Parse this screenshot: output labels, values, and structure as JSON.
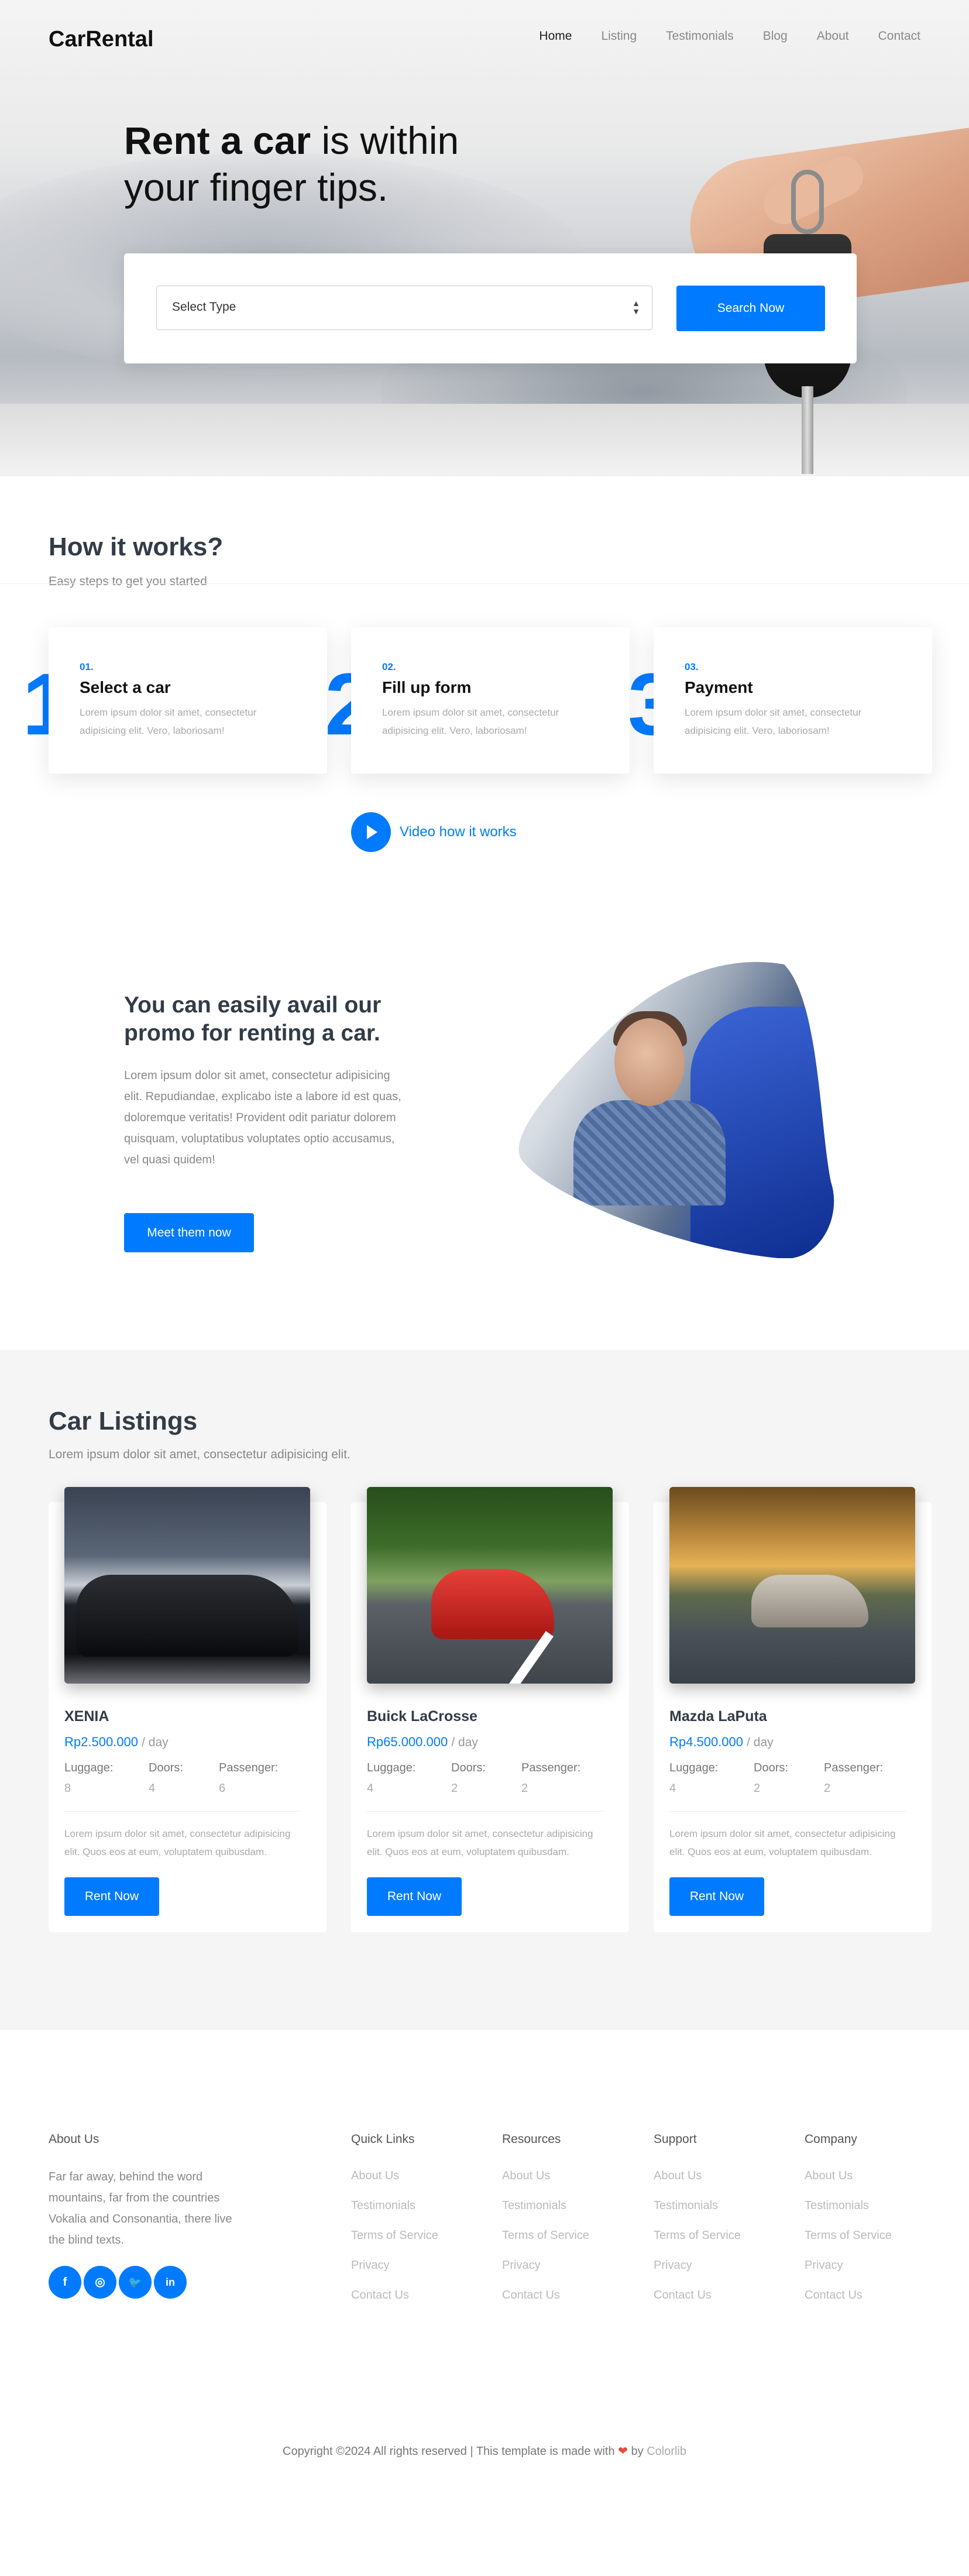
{
  "nav": {
    "logo": "CarRental",
    "items": [
      {
        "label": "Home",
        "active": true
      },
      {
        "label": "Listing"
      },
      {
        "label": "Testimonials"
      },
      {
        "label": "Blog"
      },
      {
        "label": "About"
      },
      {
        "label": "Contact"
      }
    ]
  },
  "hero": {
    "title_bold": "Rent a car",
    "title_rest1": " is within",
    "title_rest2": "your finger tips.",
    "select_value": "Select Type",
    "search_button": "Search Now"
  },
  "how": {
    "title": "How it works?",
    "subtitle": "Easy steps to get you started",
    "steps": [
      {
        "big": "1",
        "num": "01.",
        "title": "Select a car",
        "desc": "Lorem ipsum dolor sit amet, consectetur adipisicing elit. Vero, laboriosam!"
      },
      {
        "big": "2",
        "num": "02.",
        "title": "Fill up form",
        "desc": "Lorem ipsum dolor sit amet, consectetur adipisicing elit. Vero, laboriosam!"
      },
      {
        "big": "3",
        "num": "03.",
        "title": "Payment",
        "desc": "Lorem ipsum dolor sit amet, consectetur adipisicing elit. Vero, laboriosam!"
      }
    ],
    "video_link": "Video how it works"
  },
  "promo": {
    "title": "You can easily avail our promo for renting a car.",
    "text": "Lorem ipsum dolor sit amet, consectetur adipisicing elit. Repudiandae, explicabo iste a labore id est quas, doloremque veritatis! Provident odit pariatur dolorem quisquam, voluptatibus voluptates optio accusamus, vel quasi quidem!",
    "button": "Meet them now"
  },
  "listings": {
    "title": "Car Listings",
    "subtitle": "Lorem ipsum dolor sit amet, consectetur adipisicing elit.",
    "spec_labels": {
      "luggage": "Luggage:",
      "doors": "Doors:",
      "passenger": "Passenger:"
    },
    "per_day": "/ day",
    "rent_button": "Rent Now",
    "cars": [
      {
        "name": "XENIA",
        "price": "Rp2.500.000",
        "luggage": "8",
        "doors": "4",
        "passenger": "6",
        "desc": "Lorem ipsum dolor sit amet, consectetur adipisicing elit. Quos eos at eum, voluptatem quibusdam."
      },
      {
        "name": "Buick LaCrosse",
        "price": "Rp65.000.000",
        "luggage": "4",
        "doors": "2",
        "passenger": "2",
        "desc": "Lorem ipsum dolor sit amet, consectetur adipisicing elit. Quos eos at eum, voluptatem quibusdam."
      },
      {
        "name": "Mazda LaPuta",
        "price": "Rp4.500.000",
        "luggage": "4",
        "doors": "2",
        "passenger": "2",
        "desc": "Lorem ipsum dolor sit amet, consectetur adipisicing elit. Quos eos at eum, voluptatem quibusdam."
      }
    ]
  },
  "footer": {
    "about_title": "About Us",
    "about_text": "Far far away, behind the word mountains, far from the countries Vokalia and Consonantia, there live the blind texts.",
    "social": [
      {
        "icon": "facebook-icon",
        "glyph": "f"
      },
      {
        "icon": "instagram-icon",
        "glyph": "◎"
      },
      {
        "icon": "twitter-icon",
        "glyph": "🐦"
      },
      {
        "icon": "linkedin-icon",
        "glyph": "in"
      }
    ],
    "columns": [
      {
        "title": "Quick Links",
        "links": [
          "About Us",
          "Testimonials",
          "Terms of Service",
          "Privacy",
          "Contact Us"
        ]
      },
      {
        "title": "Resources",
        "links": [
          "About Us",
          "Testimonials",
          "Terms of Service",
          "Privacy",
          "Contact Us"
        ]
      },
      {
        "title": "Support",
        "links": [
          "About Us",
          "Testimonials",
          "Terms of Service",
          "Privacy",
          "Contact Us"
        ]
      },
      {
        "title": "Company",
        "links": [
          "About Us",
          "Testimonials",
          "Terms of Service",
          "Privacy",
          "Contact Us"
        ]
      }
    ],
    "copyright_pre": "Copyright ©2024 All rights reserved | This template is made with",
    "copyright_by": " by ",
    "copyright_brand": "Colorlib"
  },
  "colors": {
    "accent": "#007bff",
    "heading": "#333b47",
    "listing_bg": "#f5f5f5"
  }
}
